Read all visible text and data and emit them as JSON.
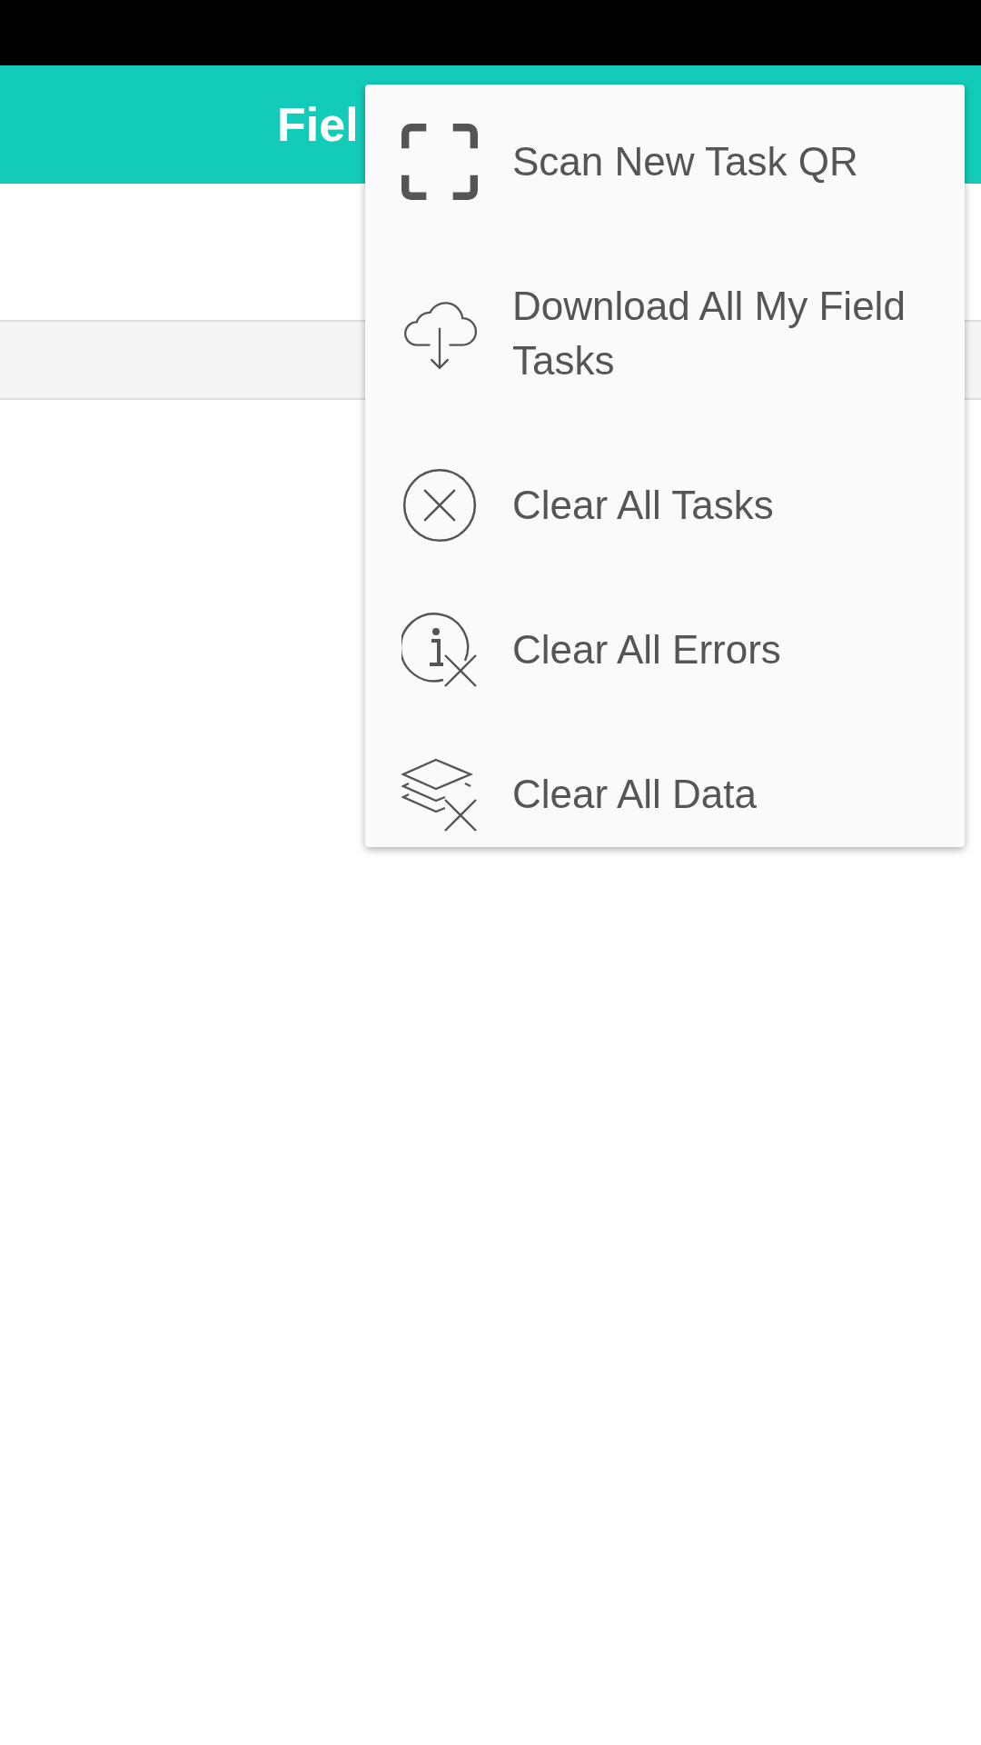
{
  "app_bar": {
    "title": "Fiel"
  },
  "menu": {
    "items": [
      {
        "label": "Scan New Task QR",
        "kind": "scan"
      },
      {
        "label": "Download All My Field Tasks",
        "kind": "download"
      },
      {
        "label": "Clear All Tasks",
        "kind": "clear"
      },
      {
        "label": "Clear All Errors",
        "kind": "errors"
      },
      {
        "label": "Clear All Data",
        "kind": "data"
      }
    ]
  }
}
